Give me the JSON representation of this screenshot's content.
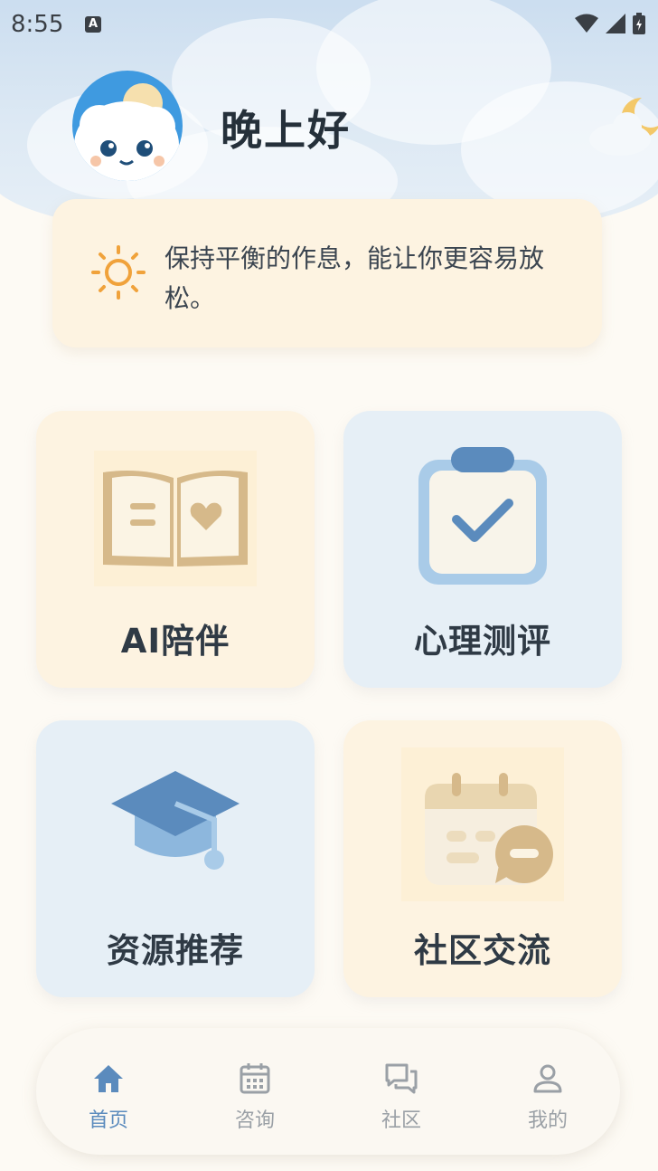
{
  "status_bar": {
    "time": "8:55",
    "notification_badge": "A"
  },
  "header": {
    "greeting": "晚上好"
  },
  "tip": {
    "text": "保持平衡的作息，能让你更容易放松。"
  },
  "features": [
    {
      "label": "AI陪伴",
      "icon": "book-heart-icon",
      "theme": "warm"
    },
    {
      "label": "心理测评",
      "icon": "clipboard-check-icon",
      "theme": "cool"
    },
    {
      "label": "资源推荐",
      "icon": "graduation-cap-icon",
      "theme": "cool"
    },
    {
      "label": "社区交流",
      "icon": "calendar-chat-icon",
      "theme": "warm"
    }
  ],
  "nav": {
    "items": [
      {
        "label": "首页",
        "icon": "home-icon",
        "active": true
      },
      {
        "label": "咨询",
        "icon": "calendar-icon",
        "active": false
      },
      {
        "label": "社区",
        "icon": "chat-icon",
        "active": false
      },
      {
        "label": "我的",
        "icon": "user-icon",
        "active": false
      }
    ]
  },
  "colors": {
    "accent": "#5b8bbd",
    "warm_card": "#fdf3e1",
    "cool_card": "#e6eff6",
    "background": "#fdfaf4"
  }
}
